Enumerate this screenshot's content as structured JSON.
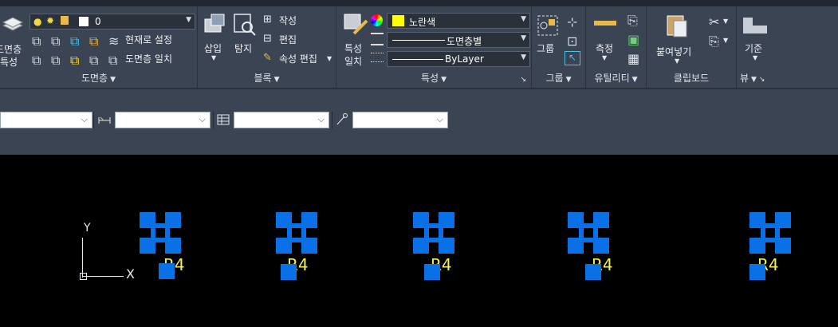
{
  "ribbon": {
    "layers": {
      "big_button_line1": "도면층",
      "big_button_line2": "특성",
      "layer_value": "0",
      "make_current": "현재로 설정",
      "match_layer": "도면층 일치",
      "panel_title": "도면층"
    },
    "block": {
      "insert": "삽입",
      "search": "탐지",
      "create": "작성",
      "edit": "편집",
      "edit_attributes": "속성 편집",
      "panel_title": "블록"
    },
    "properties": {
      "match_line1": "특성",
      "match_line2": "일치",
      "color": "노란색",
      "color_hex": "#ffff00",
      "linetype": "도면층별",
      "lineweight": "ByLayer",
      "panel_title": "특성"
    },
    "groups": {
      "group": "그룹",
      "panel_title": "그룹"
    },
    "utilities": {
      "measure": "측정",
      "panel_title": "유틸리티"
    },
    "clipboard": {
      "paste": "붙여넣기",
      "panel_title": "클립보드"
    },
    "view": {
      "base": "기준",
      "panel_title": "뷰"
    }
  },
  "blocks": [
    {
      "tag": "R4"
    },
    {
      "tag": "R4"
    },
    {
      "tag": "R4"
    },
    {
      "tag": "R4"
    },
    {
      "tag": "R4"
    }
  ],
  "ucs": {
    "x_label": "X",
    "y_label": "Y"
  },
  "colors": {
    "ribbon_bg": "#3b4453",
    "canvas_bg": "#000000",
    "block_blue": "#0a70e6",
    "text_yellow": "#f0f05a"
  }
}
